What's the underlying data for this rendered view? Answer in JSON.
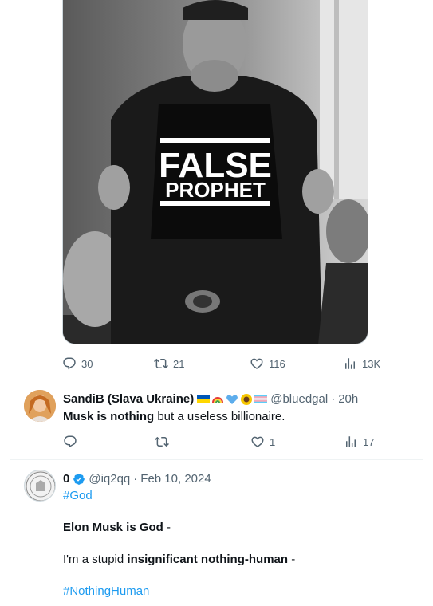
{
  "main_tweet": {
    "shirt_line1": "FALSE",
    "shirt_line2": "PROPHET",
    "stats": {
      "replies": "30",
      "reposts": "21",
      "likes": "116",
      "views": "13K"
    }
  },
  "reply1": {
    "name": "SandiB (Slava Ukraine)",
    "handle": "@bluedgal",
    "dot": "·",
    "time": "20h",
    "text_bold": "Musk is nothing",
    "text_rest": " but a useless billionaire.",
    "stats": {
      "replies": "",
      "reposts": "",
      "likes": "1",
      "views": "17"
    }
  },
  "reply2": {
    "name": "0",
    "handle": "@iq2qq",
    "dot": "·",
    "time": "Feb 10, 2024",
    "hashtag1": "#God",
    "line1_bold": "Elon Musk is God",
    "line1_rest": " -",
    "line2_start": "I'm a stupid ",
    "line2_bold": "insignificant nothing-human",
    "line2_rest": " -",
    "hashtag2": "#NothingHuman"
  },
  "colors": {
    "link": "#1d9bf0",
    "muted": "#536471",
    "text": "#0f1419",
    "verified": "#1d9bf0"
  }
}
